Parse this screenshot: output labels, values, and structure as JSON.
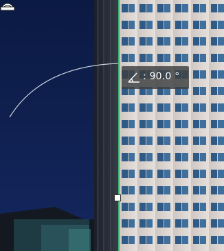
{
  "tool": {
    "angle_icon": "angle-icon",
    "rotate_handle_icon": "rotate-handle-icon"
  },
  "tooltip": {
    "angle_text": ": 90.0 °"
  },
  "colors": {
    "sky": "#0f1f4d",
    "building_light": "#d9d2cc",
    "window": "#3a5f8a",
    "guide_line": "#c9d2dc",
    "accent_edge": "#3cb371"
  }
}
